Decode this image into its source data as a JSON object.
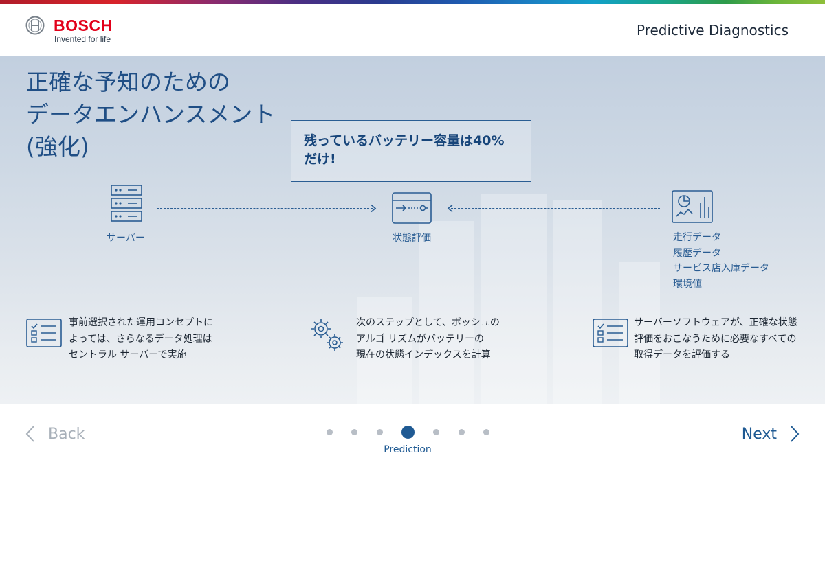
{
  "header": {
    "brand": "BOSCH",
    "slogan": "Invented for life",
    "app_title": "Predictive Diagnostics"
  },
  "hero": {
    "title_lines": [
      "正確な予知のための",
      "データエンハンスメント",
      "(強化)"
    ],
    "callout_lines": [
      "残っているバッテリー容量は40%",
      "だけ!"
    ],
    "diagram": {
      "server_label": "サーバー",
      "evaluation_label": "状態評価",
      "data_sources": [
        "走行データ",
        "履歴データ",
        "サービス店入庫データ",
        "環境値"
      ]
    },
    "notes": [
      {
        "icon": "checklist-icon",
        "lines": [
          "事前選択された運用コンセプトに",
          "よっては、さらなるデータ処理は",
          "セントラル サーバーで実施"
        ]
      },
      {
        "icon": "gears-icon",
        "lines": [
          "次のステップとして、ボッシュの",
          "アルゴ リズムがバッテリーの",
          "現在の状態インデックスを計算"
        ]
      },
      {
        "icon": "checklist-icon",
        "lines": [
          "サーバーソフトウェアが、正確な状態",
          "評価をおこなうために必要なすべての",
          "取得データを評価する"
        ]
      }
    ]
  },
  "navigation": {
    "back_label": "Back",
    "next_label": "Next",
    "total_steps": 7,
    "active_step": 4,
    "active_step_label": "Prediction"
  },
  "colors": {
    "brand_red": "#e2001a",
    "accent_blue": "#1f5a93",
    "diagram_blue": "#2a5d93",
    "inactive_dot": "#b8bec6",
    "disabled_text": "#a8b0b9"
  }
}
